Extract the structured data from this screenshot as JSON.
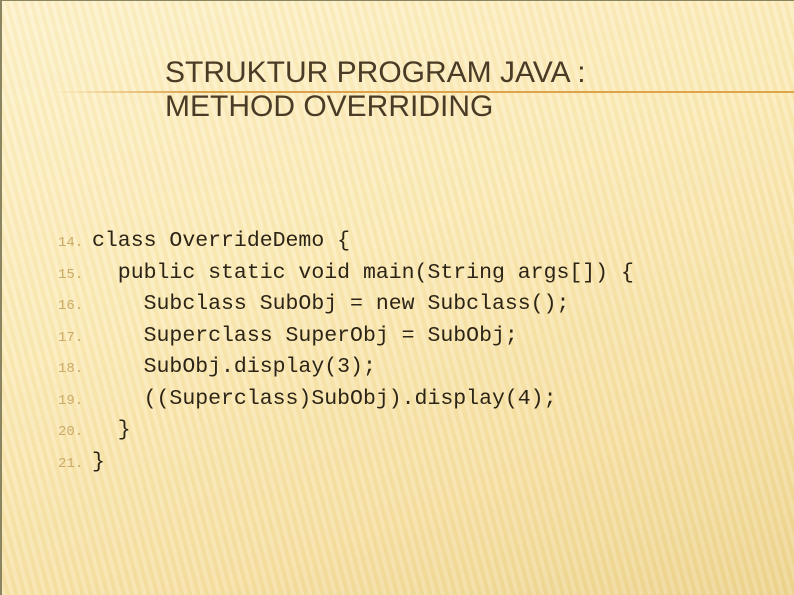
{
  "slide": {
    "title_lines": [
      "STRUKTUR PROGRAM JAVA :",
      "METHOD OVERRIDING"
    ],
    "colors": {
      "title": "#4a3b26",
      "accent_rule": "#dba24c",
      "line_number": "#c9ab6a",
      "code_text": "#2c2416",
      "background": "#fbeab6"
    },
    "code": [
      {
        "num": "14.",
        "text": "class OverrideDemo {"
      },
      {
        "num": "15.",
        "text": "  public static void main(String args[]) {"
      },
      {
        "num": "16.",
        "text": "    Subclass SubObj = new Subclass();"
      },
      {
        "num": "17.",
        "text": "    Superclass SuperObj = SubObj;"
      },
      {
        "num": "18.",
        "text": "    SubObj.display(3);"
      },
      {
        "num": "19.",
        "text": "    ((Superclass)SubObj).display(4);"
      },
      {
        "num": "20.",
        "text": "  }"
      },
      {
        "num": "21.",
        "text": "}"
      }
    ]
  }
}
